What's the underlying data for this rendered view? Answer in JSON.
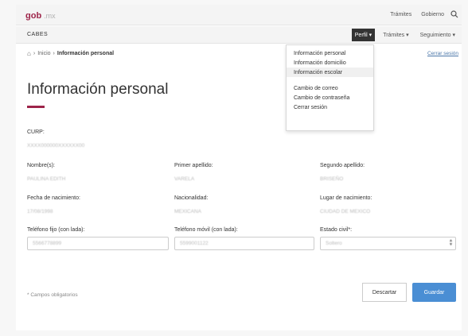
{
  "header": {
    "logo_main": "gob",
    "logo_suffix": ".mx",
    "nav": [
      "Trámites",
      "Gobierno"
    ]
  },
  "subnav": {
    "brand": "CABES",
    "menus": [
      {
        "label": "Perfil ▾",
        "active": true
      },
      {
        "label": "Trámites ▾",
        "active": false
      },
      {
        "label": "Seguimiento ▾",
        "active": false
      }
    ]
  },
  "breadcrumb": {
    "home_icon": "home-icon",
    "separator": "›",
    "inicio": "Inicio",
    "current": "Información personal"
  },
  "logout": "Cerrar sesión",
  "dropdown": {
    "items": [
      "Información personal",
      "Información domicilio",
      "Información escolar"
    ],
    "items2": [
      "Cambio de correo",
      "Cambio de contraseña",
      "Cerrar sesión"
    ],
    "highlighted_index": 2
  },
  "page": {
    "title": "Información personal"
  },
  "form": {
    "curp": {
      "label": "CURP:",
      "value": "XXXX000000XXXXXX00"
    },
    "nombre": {
      "label": "Nombre(s):",
      "value": "PAULINA EDITH"
    },
    "apellido1": {
      "label": "Primer apellido:",
      "value": "VARELA"
    },
    "apellido2": {
      "label": "Segundo apellido:",
      "value": "BRISEÑO"
    },
    "fecha": {
      "label": "Fecha de nacimiento:",
      "value": "17/08/1998"
    },
    "nacionalidad": {
      "label": "Nacionalidad:",
      "value": "MEXICANA"
    },
    "lugar": {
      "label": "Lugar de nacimiento:",
      "value": "CIUDAD DE MEXICO"
    },
    "tel_fijo": {
      "label": "Teléfono fijo (con lada):",
      "value": "5566778899"
    },
    "tel_movil": {
      "label": "Teléfono móvil (con lada):",
      "value": "5599001122"
    },
    "estado_civil": {
      "label": "Estado civil*:",
      "value": "Soltero"
    }
  },
  "footer": {
    "required_note": "* Campos obligatorios",
    "cancel_label": "Descartar",
    "save_label": "Guardar"
  },
  "colors": {
    "brand": "#9d2449",
    "primary_button": "#4a8ed4"
  }
}
